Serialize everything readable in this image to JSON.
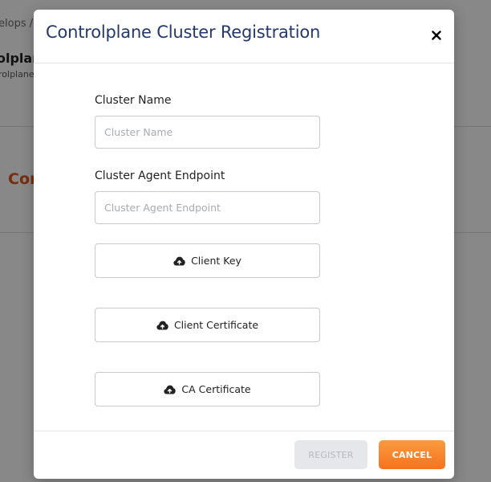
{
  "background": {
    "breadcrumb": "elops /",
    "title": "olplane",
    "subtitle": "rolplane",
    "section_title": "Con"
  },
  "modal": {
    "title": "Controlplane Cluster Registration",
    "close_label": "×"
  },
  "form": {
    "cluster_name": {
      "label": "Cluster Name",
      "placeholder": "Cluster Name",
      "value": ""
    },
    "cluster_agent_endpoint": {
      "label": "Cluster Agent Endpoint",
      "placeholder": "Cluster Agent Endpoint",
      "value": ""
    },
    "uploads": [
      {
        "label": "Client Key",
        "icon": "cloud-upload-icon"
      },
      {
        "label": "Client Certificate",
        "icon": "cloud-upload-icon"
      },
      {
        "label": "CA Certificate",
        "icon": "cloud-upload-icon"
      }
    ]
  },
  "footer": {
    "register_label": "REGISTER",
    "register_disabled": true,
    "cancel_label": "CANCEL"
  },
  "colors": {
    "title": "#25386b",
    "accent": "#f5731f",
    "disabled_bg": "#e6e7eb"
  }
}
